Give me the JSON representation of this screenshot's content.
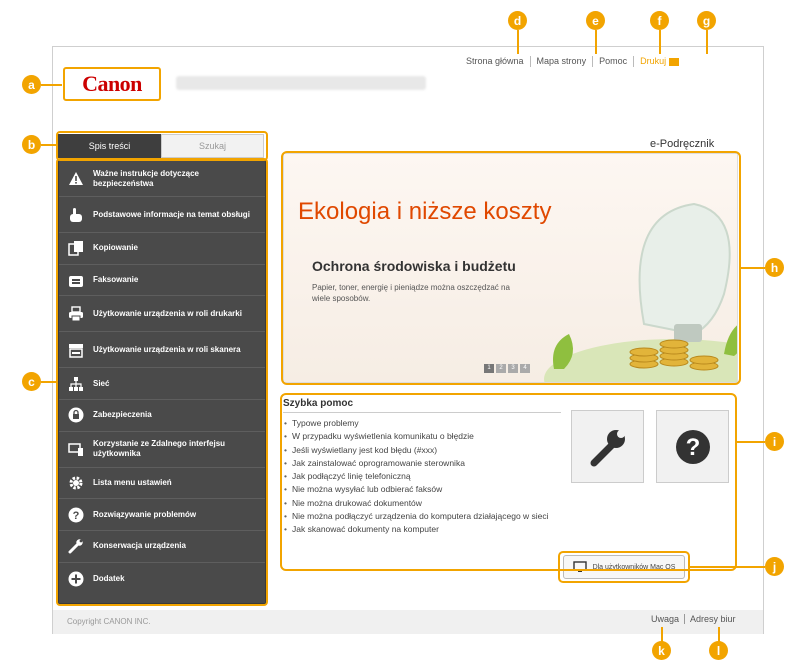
{
  "header": {
    "logo_text": "Canon",
    "top_links": [
      "Strona główna",
      "Mapa strony",
      "Pomoc",
      "Drukuj"
    ],
    "manual_title": "e-Podręcznik"
  },
  "tabs": [
    "Spis treści",
    "Szukaj"
  ],
  "sidebar": {
    "items": [
      {
        "label": "Ważne instrukcje dotyczące bezpieczeństwa",
        "icon": "warning-icon"
      },
      {
        "label": "Podstawowe informacje na temat obsługi",
        "icon": "hand-icon"
      },
      {
        "label": "Kopiowanie",
        "icon": "copy-icon"
      },
      {
        "label": "Faksowanie",
        "icon": "fax-icon"
      },
      {
        "label": "Użytkowanie urządzenia w roli drukarki",
        "icon": "printer-icon"
      },
      {
        "label": "Użytkowanie urządzenia w roli skanera",
        "icon": "scanner-icon"
      },
      {
        "label": "Sieć",
        "icon": "network-icon"
      },
      {
        "label": "Zabezpieczenia",
        "icon": "lock-icon"
      },
      {
        "label": "Korzystanie ze Zdalnego interfejsu użytkownika",
        "icon": "remote-ui-icon"
      },
      {
        "label": "Lista menu ustawień",
        "icon": "gear-icon"
      },
      {
        "label": "Rozwiązywanie problemów",
        "icon": "question-icon"
      },
      {
        "label": "Konserwacja urządzenia",
        "icon": "wrench-icon"
      },
      {
        "label": "Dodatek",
        "icon": "plus-icon"
      }
    ]
  },
  "banner": {
    "title": "Ekologia i niższe koszty",
    "subtitle": "Ochrona środowiska i budżetu",
    "text": "Papier, toner, energię i pieniądze można oszczędzać na wiele sposobów.",
    "pages": [
      "1",
      "2",
      "3",
      "4"
    ]
  },
  "quick_help": {
    "title": "Szybka pomoc",
    "items": [
      "Typowe problemy",
      "W przypadku wyświetlenia komunikatu o błędzie",
      "Jeśli wyświetlany jest kod błędu (#xxx)",
      "Jak zainstalować oprogramowanie sterownika",
      "Jak podłączyć linię telefoniczną",
      "Nie można wysyłać lub odbierać faksów",
      "Nie można drukować dokumentów",
      "Nie można podłączyć urządzenia do komputera działającego w sieci",
      "Jak skanować dokumenty na komputer"
    ]
  },
  "mac_button": "Dla użytkowników Mac OS",
  "footer": {
    "copyright": "Copyright CANON INC.",
    "links": [
      "Uwaga",
      "Adresy biur"
    ]
  },
  "callouts": [
    "a",
    "b",
    "c",
    "d",
    "e",
    "f",
    "g",
    "h",
    "i",
    "j",
    "k",
    "l"
  ],
  "colors": {
    "accent": "#f2a400",
    "brand": "#cc0000",
    "sidebar": "#4a4a4a"
  }
}
